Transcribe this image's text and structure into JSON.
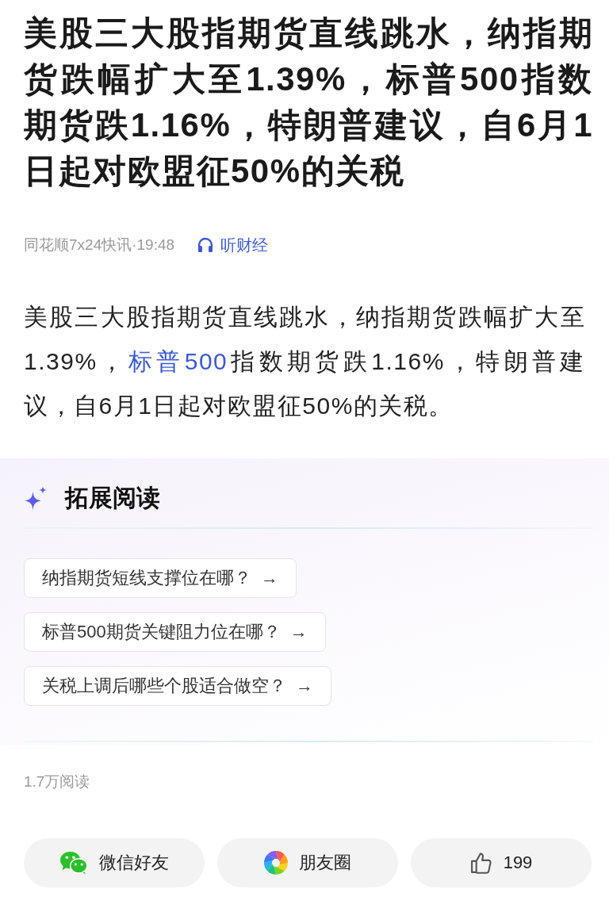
{
  "title": "美股三大股指期货直线跳水，纳指期货跌幅扩大至1.39%，标普500指数期货跌1.16%，特朗普建议，自6月1日起对欧盟征50%的关税",
  "meta": {
    "source": "同花顺7x24快讯·19:48",
    "listen": "听财经"
  },
  "body": [
    {
      "kind": "text",
      "text": "美股三大股指期货直线跳水，纳指期货跌幅扩大至1.39%，"
    },
    {
      "kind": "link",
      "text": "标普500"
    },
    {
      "kind": "text",
      "text": "指数期货跌1.16%，特朗普建议，自6月1日起对欧盟征50%的关税。"
    }
  ],
  "related": {
    "heading": "拓展阅读",
    "questions": [
      {
        "text": "纳指期货短线支撑位在哪？",
        "arrow": "→"
      },
      {
        "text": "标普500期货关键阻力位在哪？",
        "arrow": "→"
      },
      {
        "text": "关税上调后哪些个股适合做空？",
        "arrow": "→"
      }
    ]
  },
  "read_count": "1.7万阅读",
  "actions": [
    {
      "kind": "wechat",
      "label": "微信好友"
    },
    {
      "kind": "moments",
      "label": "朋友圈"
    },
    {
      "kind": "like",
      "label": "199"
    }
  ]
}
